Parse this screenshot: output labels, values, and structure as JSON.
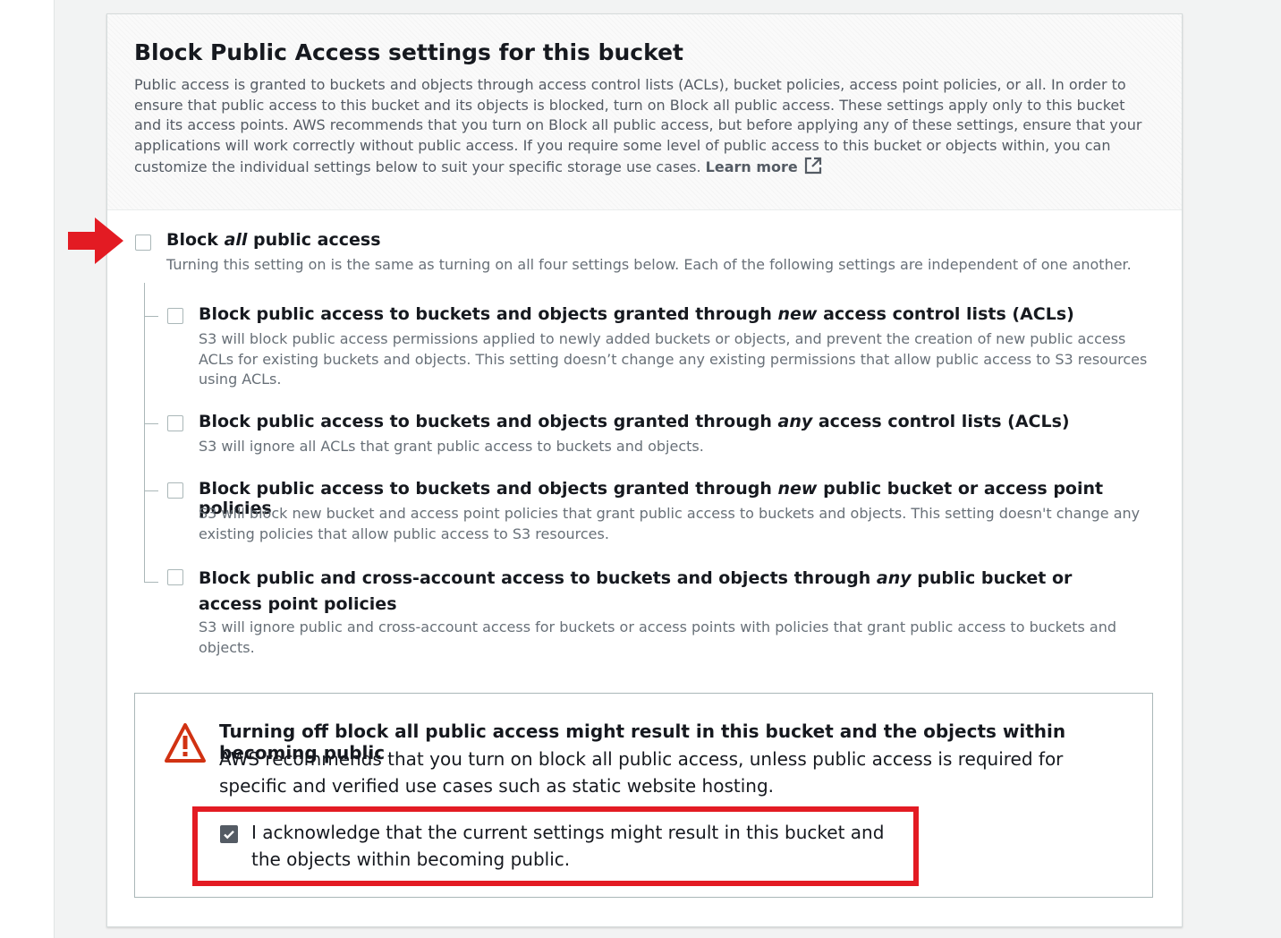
{
  "header": {
    "title": "Block Public Access settings for this bucket",
    "description": "Public access is granted to buckets and objects through access control lists (ACLs), bucket policies, access point policies, or all. In order to ensure that public access to this bucket and its objects is blocked, turn on Block all public access. These settings apply only to this bucket and its access points. AWS recommends that you turn on Block all public access, but before applying any of these settings, ensure that your applications will work correctly without public access. If you require some level of public access to this bucket or objects within, you can customize the individual settings below to suit your specific storage use cases.",
    "learn_more": "Learn more"
  },
  "block_all": {
    "label_pre": "Block ",
    "label_em": "all",
    "label_post": " public access",
    "description": "Turning this setting on is the same as turning on all four settings below. Each of the following settings are independent of one another.",
    "checked": false
  },
  "options": [
    {
      "label_pre": "Block public access to buckets and objects granted through ",
      "label_em": "new",
      "label_post": " access control lists (ACLs)",
      "description": "S3 will block public access permissions applied to newly added buckets or objects, and prevent the creation of new public access ACLs for existing buckets and objects. This setting doesn’t change any existing permissions that allow public access to S3 resources using ACLs.",
      "checked": false
    },
    {
      "label_pre": "Block public access to buckets and objects granted through ",
      "label_em": "any",
      "label_post": " access control lists (ACLs)",
      "description": "S3 will ignore all ACLs that grant public access to buckets and objects.",
      "checked": false
    },
    {
      "label_pre": "Block public access to buckets and objects granted through ",
      "label_em": "new",
      "label_post": " public bucket or access point policies",
      "description": "S3 will block new bucket and access point policies that grant public access to buckets and objects. This setting doesn't change any existing policies that allow public access to S3 resources.",
      "checked": false
    },
    {
      "label_pre": "Block public and cross-account access to buckets and objects through ",
      "label_em": "any",
      "label_post": " public bucket or access point policies",
      "description": "S3 will ignore public and cross-account access for buckets or access points with policies that grant public access to buckets and objects.",
      "checked": false
    }
  ],
  "warning": {
    "title": "Turning off block all public access might result in this bucket and the objects within becoming public",
    "description": "AWS recommends that you turn on block all public access, unless public access is required for specific and verified use cases such as static website hosting.",
    "acknowledge_label": "I acknowledge that the current settings might result in this bucket and the objects within becoming public.",
    "acknowledge_checked": true
  },
  "colors": {
    "annotation_red": "#e31b23",
    "checked_fill": "#545b64",
    "warning_red": "#d13212"
  }
}
